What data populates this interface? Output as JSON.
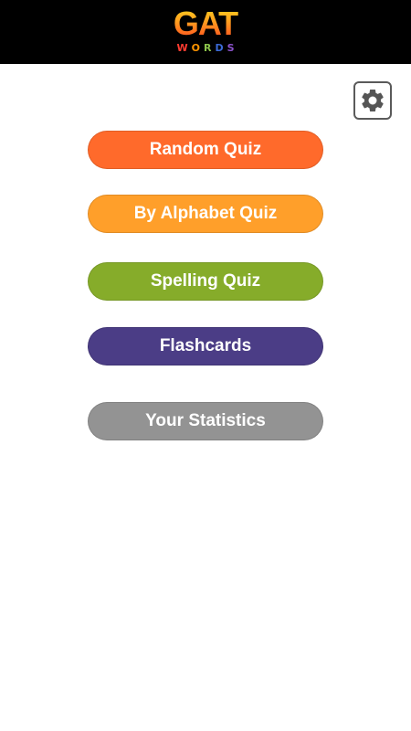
{
  "header": {
    "logo_main": "GAT",
    "logo_sub_letters": [
      {
        "char": "W",
        "color": "#ff3b30"
      },
      {
        "char": "O",
        "color": "#ff9500"
      },
      {
        "char": "R",
        "color": "#8bc34a"
      },
      {
        "char": "D",
        "color": "#3b6ad6"
      },
      {
        "char": "S",
        "color": "#8a52c9"
      }
    ],
    "background": "#000000"
  },
  "settings": {
    "icon": "gear-icon"
  },
  "menu": {
    "buttons": [
      {
        "label": "Random Quiz",
        "color": "#ff6a2b"
      },
      {
        "label": "By Alphabet Quiz",
        "color": "#ff9f2a"
      },
      {
        "label": "Spelling Quiz",
        "color": "#86ac2a"
      },
      {
        "label": "Flashcards",
        "color": "#4b3d86"
      },
      {
        "label": "Your Statistics",
        "color": "#939393"
      }
    ]
  }
}
